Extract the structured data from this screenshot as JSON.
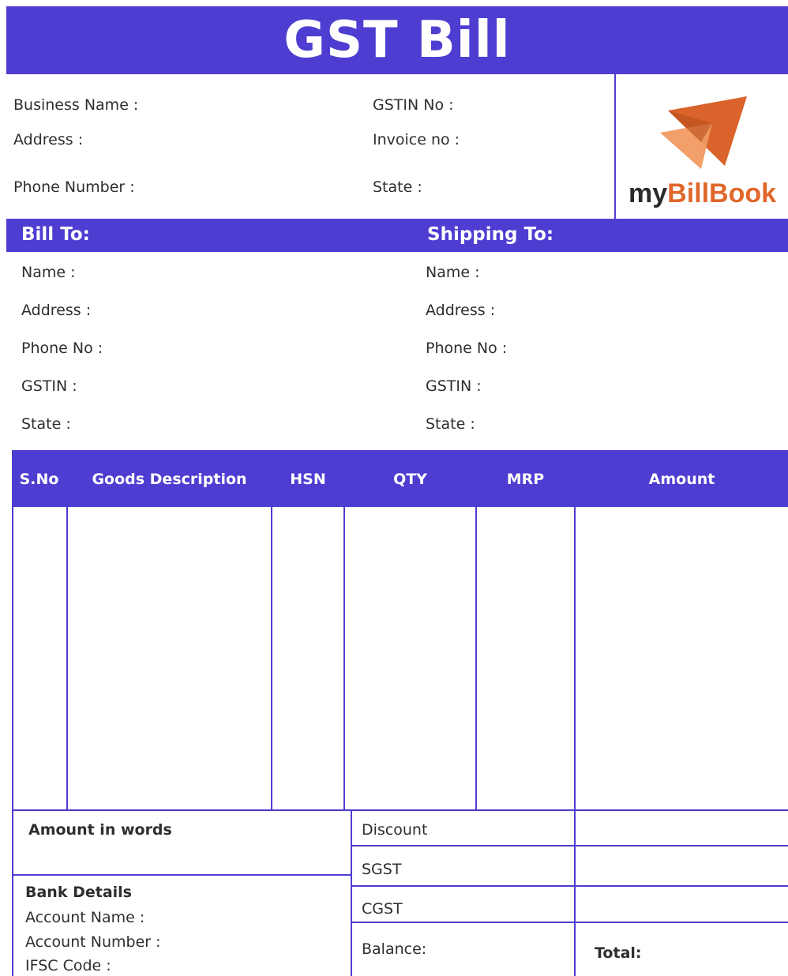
{
  "title": "GST Bill",
  "brand": {
    "logo_part1": "my",
    "logo_part2": "BillBook",
    "color_dark": "#2b2b2b",
    "color_orange": "#e0672a"
  },
  "business": {
    "name_label": "Business Name :",
    "address_label": "Address :",
    "phone_label": "Phone Number :",
    "gstin_label": "GSTIN No :",
    "invoice_label": "Invoice no :",
    "state_label": "State :"
  },
  "bill_to": {
    "heading": "Bill To:",
    "fields": [
      "Name :",
      "Address :",
      "Phone No :",
      "GSTIN :",
      "State :"
    ]
  },
  "ship_to": {
    "heading": "Shipping To:",
    "fields": [
      "Name :",
      "Address :",
      "Phone No :",
      "GSTIN :",
      "State :"
    ]
  },
  "table": {
    "columns": [
      "S.No",
      "Goods Description",
      "HSN",
      "QTY",
      "MRP",
      "Amount"
    ]
  },
  "footer": {
    "amount_words": "Amount in words",
    "bank_heading": "Bank Details",
    "account_name": "Account Name :",
    "account_number": "Account Number :",
    "ifsc": "IFSC Code :",
    "discount": "Discount",
    "sgst": "SGST",
    "cgst": "CGST",
    "balance": "Balance:",
    "total": "Total:"
  },
  "colors": {
    "accent": "#4e3dd1"
  }
}
